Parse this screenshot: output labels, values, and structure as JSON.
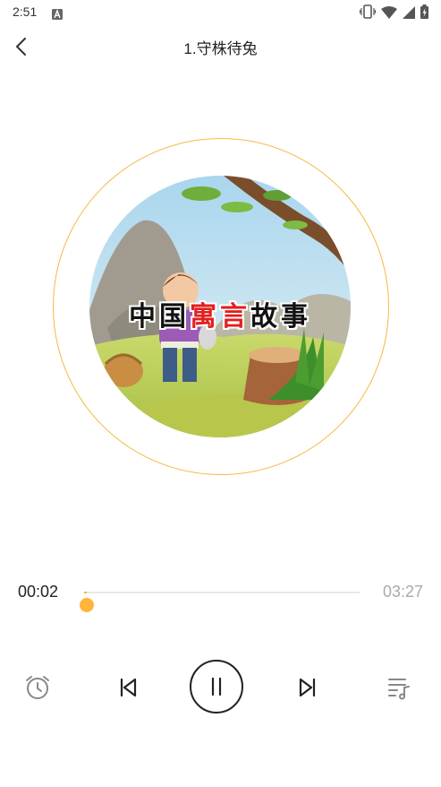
{
  "status_bar": {
    "time": "2:51"
  },
  "header": {
    "title": "1.守株待兔",
    "back_icon": "chevron-left-icon"
  },
  "cover": {
    "title_1": "中国",
    "title_2": "寓言",
    "title_3": "故事"
  },
  "player": {
    "current_time": "00:02",
    "total_time": "03:27",
    "progress_fraction": 0.01,
    "accent_color": "#ffb43c",
    "ring_color": "#f5b942"
  },
  "controls": {
    "icons": [
      "alarm-clock-icon",
      "skip-previous-icon",
      "pause-icon",
      "skip-next-icon",
      "playlist-music-icon"
    ]
  }
}
